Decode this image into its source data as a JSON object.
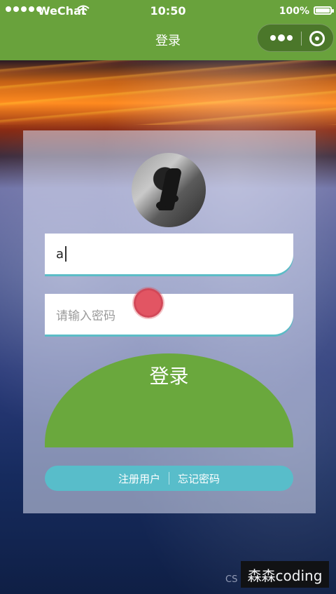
{
  "status_bar": {
    "carrier": "WeChat",
    "time": "10:50",
    "battery": "100%"
  },
  "nav": {
    "title": "登录",
    "capsule_icons": [
      "more-dots-icon",
      "close-target-icon"
    ]
  },
  "form": {
    "username_value": "a",
    "password_placeholder": "请输入密码",
    "login_label": "登录",
    "register_label": "注册用户",
    "forgot_label": "忘记密码"
  },
  "watermark": {
    "cs_text": "CS",
    "channel": "森森coding"
  },
  "colors": {
    "primary_green": "#69a23c",
    "accent_teal": "#58bdca",
    "touch_red": "#e25563"
  }
}
